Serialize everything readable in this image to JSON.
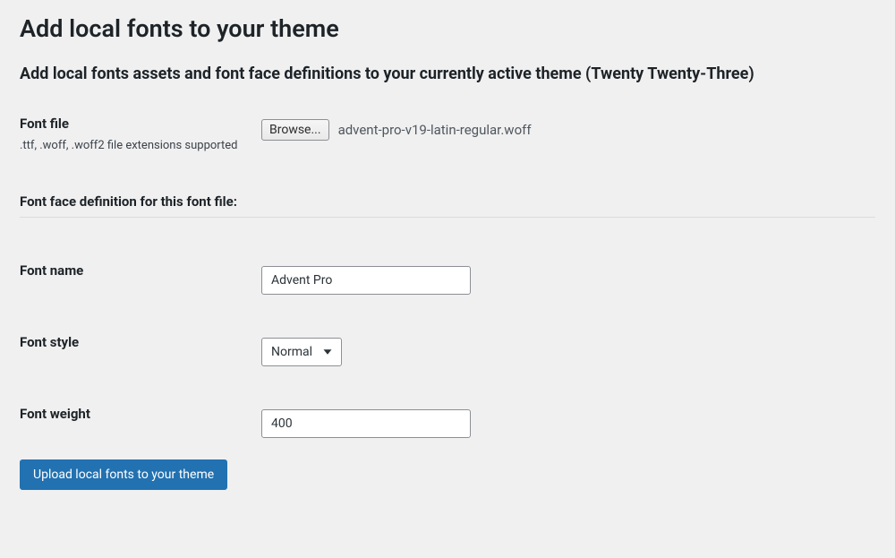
{
  "page": {
    "title": "Add local fonts to your theme",
    "subtitle": "Add local fonts assets and font face definitions to your currently active theme (Twenty Twenty-Three)"
  },
  "fields": {
    "fontFile": {
      "label": "Font file",
      "description": ".ttf, .woff, .woff2 file extensions supported",
      "browseLabel": "Browse...",
      "selectedFile": "advent-pro-v19-latin-regular.woff"
    },
    "definitionHeader": {
      "label": "Font face definition for this font file:"
    },
    "fontName": {
      "label": "Font name",
      "value": "Advent Pro"
    },
    "fontStyle": {
      "label": "Font style",
      "value": "Normal"
    },
    "fontWeight": {
      "label": "Font weight",
      "value": "400"
    }
  },
  "actions": {
    "uploadLabel": "Upload local fonts to your theme"
  }
}
